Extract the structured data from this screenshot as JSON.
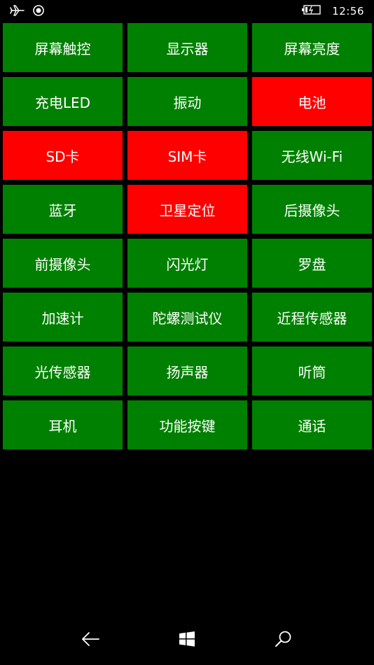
{
  "status_bar": {
    "time": "12:56",
    "icons": [
      "airplane-icon",
      "location-icon",
      "battery-charging-icon"
    ]
  },
  "colors": {
    "pass": "#008000",
    "fail": "#ff0000",
    "background": "#000000",
    "text": "#ffffff"
  },
  "tests": [
    {
      "label": "屏幕触控",
      "status": "pass"
    },
    {
      "label": "显示器",
      "status": "pass"
    },
    {
      "label": "屏幕亮度",
      "status": "pass"
    },
    {
      "label": "充电LED",
      "status": "pass"
    },
    {
      "label": "振动",
      "status": "pass"
    },
    {
      "label": "电池",
      "status": "fail"
    },
    {
      "label": "SD卡",
      "status": "fail"
    },
    {
      "label": "SIM卡",
      "status": "fail"
    },
    {
      "label": "无线Wi-Fi",
      "status": "pass"
    },
    {
      "label": "蓝牙",
      "status": "pass"
    },
    {
      "label": "卫星定位",
      "status": "fail"
    },
    {
      "label": "后摄像头",
      "status": "pass"
    },
    {
      "label": "前摄像头",
      "status": "pass"
    },
    {
      "label": "闪光灯",
      "status": "pass"
    },
    {
      "label": "罗盘",
      "status": "pass"
    },
    {
      "label": "加速计",
      "status": "pass"
    },
    {
      "label": "陀螺测试仪",
      "status": "pass"
    },
    {
      "label": "近程传感器",
      "status": "pass"
    },
    {
      "label": "光传感器",
      "status": "pass"
    },
    {
      "label": "扬声器",
      "status": "pass"
    },
    {
      "label": "听筒",
      "status": "pass"
    },
    {
      "label": "耳机",
      "status": "pass"
    },
    {
      "label": "功能按键",
      "status": "pass"
    },
    {
      "label": "通话",
      "status": "pass"
    }
  ],
  "nav_bar": {
    "buttons": [
      "back-icon",
      "windows-start-icon",
      "search-icon"
    ]
  }
}
